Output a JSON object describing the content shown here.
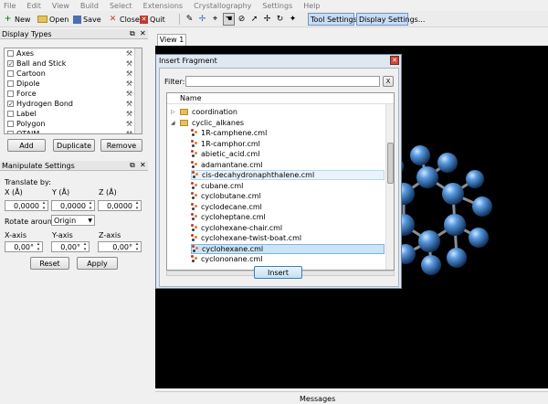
{
  "menu": [
    "File",
    "Edit",
    "View",
    "Build",
    "Select",
    "Extensions",
    "Crystallography",
    "Settings",
    "Help"
  ],
  "toolbar": {
    "new_label": "New",
    "open_label": "Open",
    "save_label": "Save",
    "close_label": "Close",
    "quit_label": "Quit",
    "tool_settings_label": "Tool Settings...",
    "display_settings_label": "Display Settings..."
  },
  "display_types": {
    "title": "Display Types",
    "items": [
      {
        "label": "Axes",
        "checked": false
      },
      {
        "label": "Ball and Stick",
        "checked": true
      },
      {
        "label": "Cartoon",
        "checked": false
      },
      {
        "label": "Dipole",
        "checked": false
      },
      {
        "label": "Force",
        "checked": false
      },
      {
        "label": "Hydrogen Bond",
        "checked": true
      },
      {
        "label": "Label",
        "checked": false
      },
      {
        "label": "Polygon",
        "checked": false
      },
      {
        "label": "QTAIM",
        "checked": false
      }
    ],
    "add_label": "Add",
    "duplicate_label": "Duplicate",
    "remove_label": "Remove"
  },
  "manipulate": {
    "title": "Manipulate Settings",
    "translate_label": "Translate by:",
    "x_label": "X (Å)",
    "y_label": "Y (Å)",
    "z_label": "Z (Å)",
    "x_value": "0,0000",
    "y_value": "0,0000",
    "z_value": "0,0000",
    "rotate_label": "Rotate around:",
    "rotate_value": "Origin",
    "xaxis_label": "X-axis",
    "yaxis_label": "Y-axis",
    "zaxis_label": "Z-axis",
    "xaxis_value": "0,00°",
    "yaxis_value": "0,00°",
    "zaxis_value": "0,00°",
    "reset_label": "Reset",
    "apply_label": "Apply"
  },
  "view_tab": "View 1",
  "dialog": {
    "title": "Insert Fragment",
    "filter_label": "Filter:",
    "filter_value": "",
    "clear_label": "X",
    "column_name": "Name",
    "folders": [
      {
        "label": "coordination",
        "expanded": false
      },
      {
        "label": "cyclic_alkanes",
        "expanded": true
      }
    ],
    "files": [
      "1R-camphene.cml",
      "1R-camphor.cml",
      "abietic_acid.cml",
      "adamantane.cml",
      "cis-decahydronaphthalene.cml",
      "cubane.cml",
      "cyclobutane.cml",
      "cyclodecane.cml",
      "cycloheptane.cml",
      "cyclohexane-chair.cml",
      "cyclohexane-twist-boat.cml",
      "cyclohexane.cml",
      "cyclononane.cml"
    ],
    "selected_file": "cyclohexane.cml",
    "hovered_file": "cis-decahydronaphthalene.cml",
    "insert_label": "Insert"
  },
  "status": {
    "messages_label": "Messages"
  },
  "colors": {
    "accent": "#3399ff",
    "atom": "#4a8fd6",
    "viewport": "#000000",
    "selection": "#cce4f7"
  }
}
